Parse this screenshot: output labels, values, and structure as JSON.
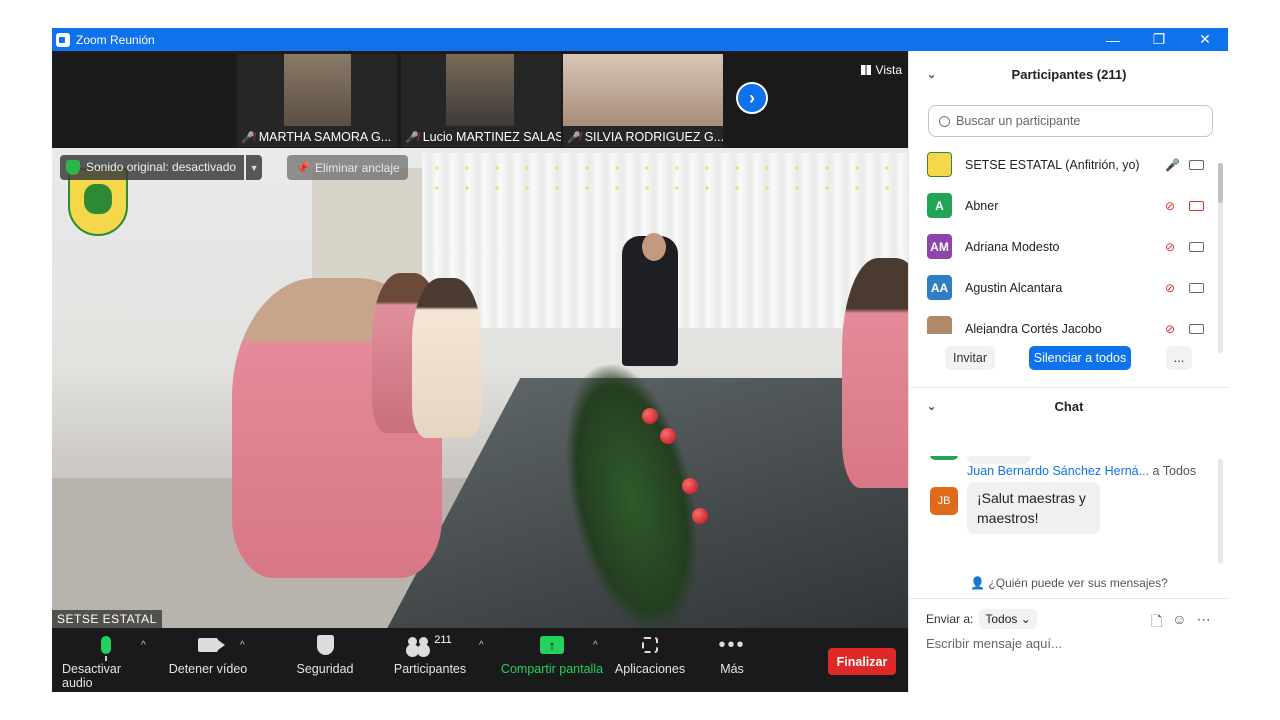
{
  "window": {
    "title": "Zoom Reunión",
    "minimize": "—",
    "restore": "❐",
    "close": "✕"
  },
  "thumbnails": [
    {
      "name": "MARTHA SAMORA G..."
    },
    {
      "name": "Lucio MARTINEZ SALAS"
    },
    {
      "name": "SILVIA RODRIGUEZ G..."
    }
  ],
  "view_label": "Vista",
  "main_video": {
    "original_sound": "Sonido original: desactivado",
    "unpin": "Eliminar anclaje",
    "speaker_name": "SETSE ESTATAL"
  },
  "toolbar": {
    "mute_label": "Desactivar audio",
    "video_label": "Detener vídeo",
    "security_label": "Seguridad",
    "participants_label": "Participantes",
    "participants_count": "211",
    "share_label": "Compartir pantalla",
    "apps_label": "Aplicaciones",
    "more_label": "Más",
    "end_label": "Finalizar"
  },
  "participants_panel": {
    "header": "Participantes (211)",
    "search_placeholder": "Buscar un participante",
    "items": [
      {
        "initials": "",
        "name": "SETSE ESTATAL (Anfitrión, yo)",
        "color": "#f5d84a"
      },
      {
        "initials": "A",
        "name": "Abner",
        "color": "#23a455"
      },
      {
        "initials": "AM",
        "name": "Adriana Modesto",
        "color": "#8e44ad"
      },
      {
        "initials": "AA",
        "name": "Agustin Alcantara",
        "color": "#2f7ec2"
      },
      {
        "initials": "",
        "name": "Alejandra Cortés Jacobo",
        "color": "#b08968"
      }
    ],
    "invite": "Invitar",
    "mute_all": "Silenciar a todos",
    "more": "..."
  },
  "chat_panel": {
    "header": "Chat",
    "message": {
      "sender": "Juan Bernardo Sánchez Herná...",
      "to": "a Todos",
      "initials": "JB",
      "text": "¡Salut maestras y maestros!"
    },
    "who_sees": "¿Quién puede ver sus mensajes?",
    "send_to_label": "Enviar a:",
    "send_to_value": "Todos",
    "input_placeholder": "Escribir mensaje aquí..."
  }
}
